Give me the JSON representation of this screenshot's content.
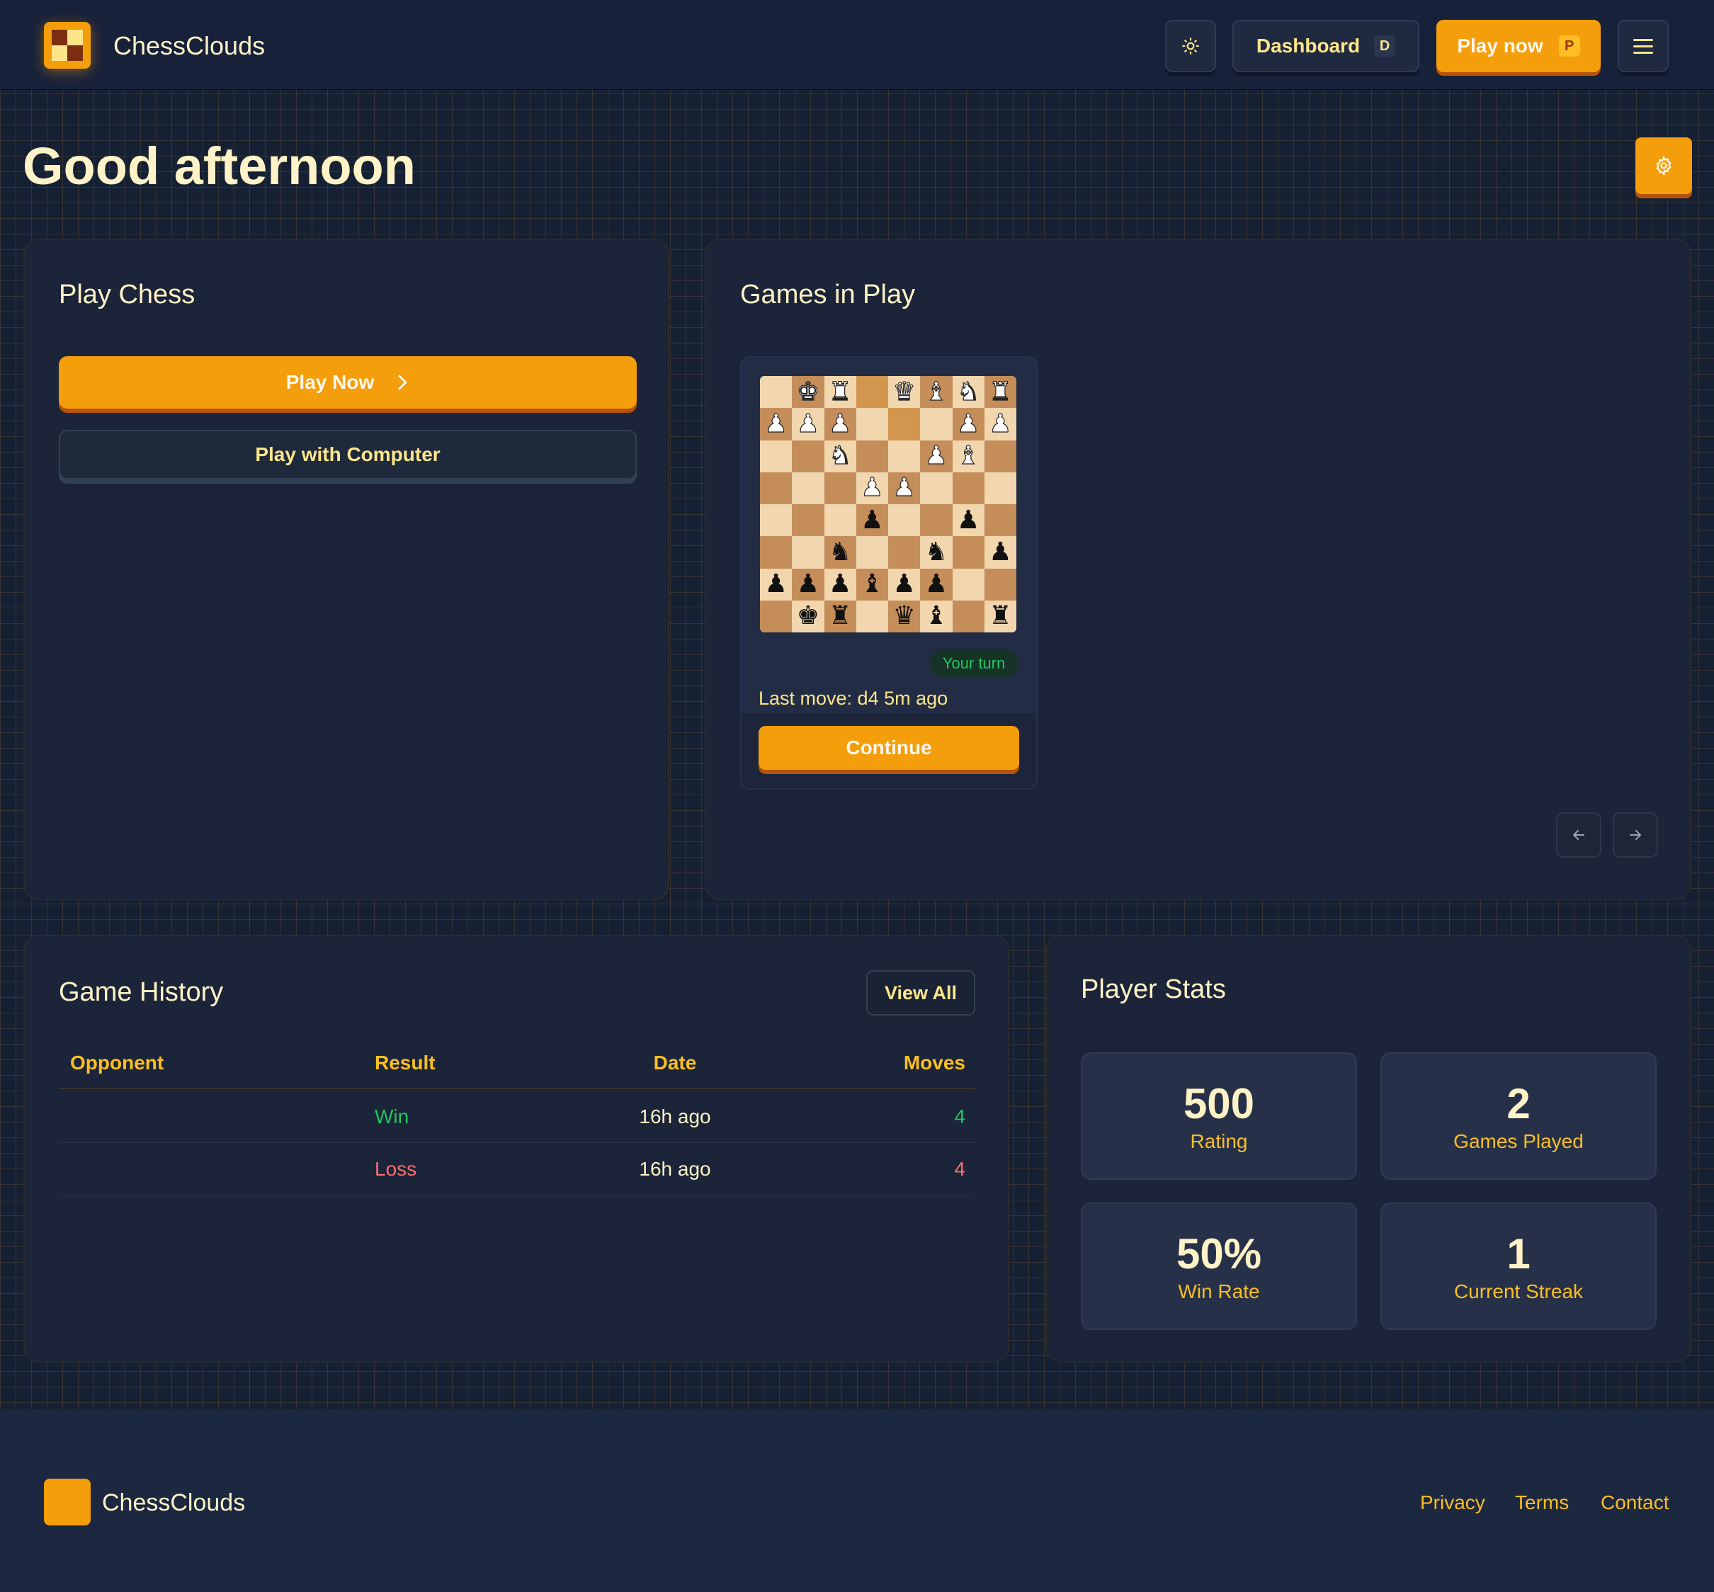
{
  "header": {
    "brand": "ChessClouds",
    "dashboard_label": "Dashboard",
    "dashboard_key": "D",
    "play_label": "Play now",
    "play_key": "P"
  },
  "greeting": "Good afternoon",
  "play_card": {
    "title": "Play Chess",
    "play_now": "Play Now",
    "play_computer": "Play with Computer"
  },
  "games_card": {
    "title": "Games in Play",
    "games": [
      {
        "status": "Your turn",
        "last_move": "Last move: d4 5m ago",
        "continue_label": "Continue",
        "board": [
          [
            "",
            "K",
            "R",
            "",
            "Q",
            "B",
            "N",
            "R"
          ],
          [
            "P",
            "P",
            "P",
            "",
            "",
            "",
            "P",
            "P"
          ],
          [
            "",
            "",
            "N",
            "",
            "",
            "P",
            "B",
            ""
          ],
          [
            "",
            "",
            "",
            "P",
            "P",
            "",
            "",
            ""
          ],
          [
            "",
            "",
            "",
            "p",
            "",
            "",
            "p",
            ""
          ],
          [
            "",
            "",
            "n",
            "",
            "",
            "n",
            "",
            "p"
          ],
          [
            "p",
            "p",
            "p",
            "b",
            "p",
            "p",
            "",
            ""
          ],
          [
            "",
            "k",
            "r",
            "",
            "q",
            "b",
            "",
            "r"
          ]
        ]
      }
    ]
  },
  "history": {
    "title": "Game History",
    "view_all": "View All",
    "columns": [
      "Opponent",
      "Result",
      "Date",
      "Moves"
    ],
    "rows": [
      {
        "opponent": "",
        "result": "Win",
        "date": "16h ago",
        "moves": "4"
      },
      {
        "opponent": "",
        "result": "Loss",
        "date": "16h ago",
        "moves": "4"
      }
    ]
  },
  "stats": {
    "title": "Player Stats",
    "items": [
      {
        "value": "500",
        "label": "Rating"
      },
      {
        "value": "2",
        "label": "Games Played"
      },
      {
        "value": "50%",
        "label": "Win Rate"
      },
      {
        "value": "1",
        "label": "Current Streak"
      }
    ]
  },
  "footer": {
    "brand": "ChessClouds",
    "links": [
      "Privacy",
      "Terms",
      "Contact"
    ]
  },
  "colors": {
    "accent": "#f59e0b",
    "win": "#22c55e",
    "loss": "#f87171",
    "background": "#162033"
  },
  "icons": [
    "sun-icon",
    "hamburger-menu-icon",
    "gear-icon",
    "chevron-right-icon",
    "arrow-left-icon",
    "arrow-right-icon"
  ]
}
